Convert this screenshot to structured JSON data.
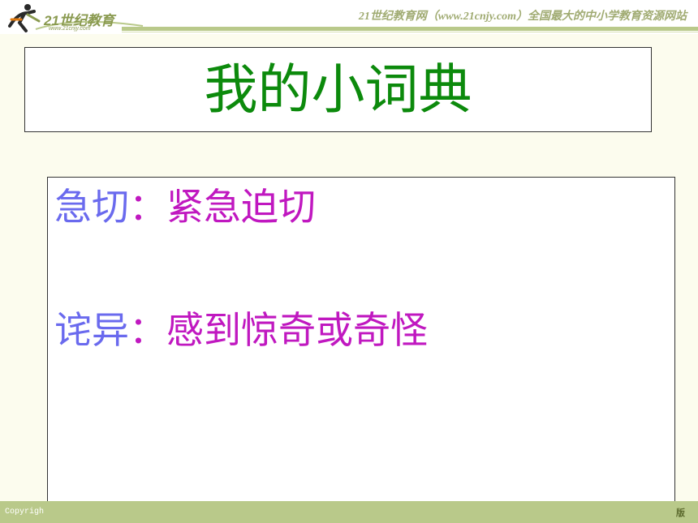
{
  "header": {
    "logo_text": "21世纪教育",
    "logo_url": "www.21cnjy.com",
    "tagline": "21世纪教育网（www.21cnjy.com）全国最大的中小学教育资源网站"
  },
  "title": "我的小词典",
  "entries": [
    {
      "term": "急切",
      "colon": "：",
      "definition": "紧急迫切"
    },
    {
      "term": "诧异",
      "colon": "：",
      "definition": "感到惊奇或奇怪"
    }
  ],
  "footer": {
    "left_text": "Copyrigh",
    "right_text": "版"
  },
  "colors": {
    "title": "#0c8a0c",
    "term": "#6a6aee",
    "definition": "#c018c0",
    "accent_bar": "#b9c98a"
  }
}
